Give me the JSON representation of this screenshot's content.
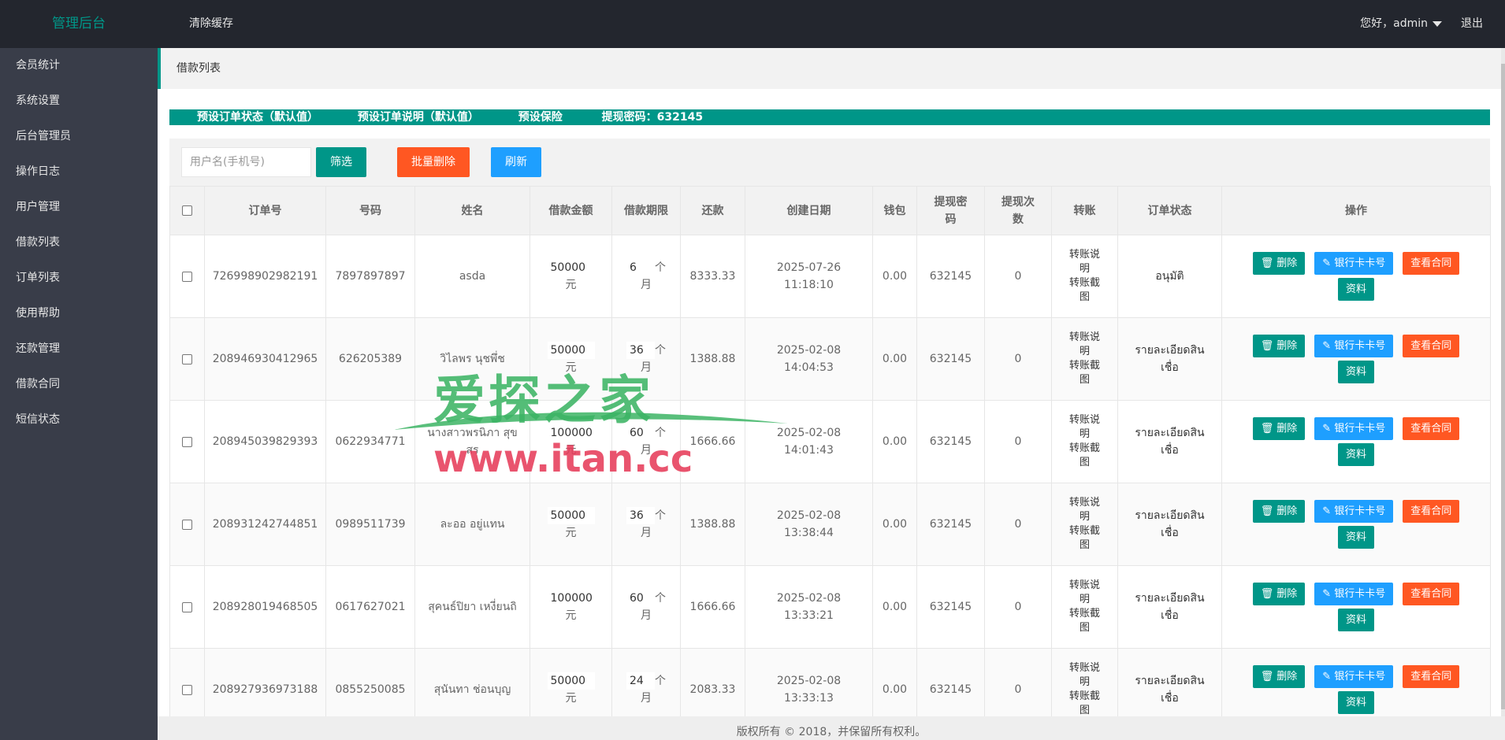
{
  "header": {
    "logo": "管理后台",
    "clear_cache": "清除缓存",
    "greeting": "您好，admin",
    "logout": "退出"
  },
  "sidebar": {
    "items": [
      {
        "label": "会员统计"
      },
      {
        "label": "系统设置"
      },
      {
        "label": "后台管理员"
      },
      {
        "label": "操作日志"
      },
      {
        "label": "用户管理"
      },
      {
        "label": "借款列表"
      },
      {
        "label": "订单列表"
      },
      {
        "label": "使用帮助"
      },
      {
        "label": "还款管理"
      },
      {
        "label": "借款合同"
      },
      {
        "label": "短信状态"
      }
    ]
  },
  "breadcrumb": "借款列表",
  "notice": {
    "status_default": "预设订单状态（默认值）",
    "desc_default": "预设订单说明（默认值）",
    "insurance": "预设保险",
    "withdraw_pw": "提现密码：632145"
  },
  "toolbar": {
    "search_placeholder": "用户名(手机号)",
    "filter": "筛选",
    "batch_delete": "批量删除",
    "refresh": "刷新"
  },
  "table": {
    "headers": [
      "订单号",
      "号码",
      "姓名",
      "借款金额",
      "借款期限",
      "还款",
      "创建日期",
      "钱包",
      "提现密\n码",
      "提现次\n数",
      "转账",
      "订单状态",
      "操作"
    ],
    "amount_unit": "元",
    "term_unit_1": "个",
    "term_unit_2": "月",
    "transfer_line1": "转账说\n明",
    "transfer_line2": "转账截\n图",
    "ops": {
      "delete": "删除",
      "bank": "银行卡卡号",
      "contract": "查看合同",
      "info": "资料"
    },
    "rows": [
      {
        "order": "726998902982191",
        "phone": "7897897897",
        "name": "asda",
        "amount": "50000",
        "term": "6",
        "repay": "8333.33",
        "date": "2025-07-26",
        "time": "11:18:10",
        "wallet": "0.00",
        "pw": "632145",
        "count": "0",
        "status": "อนุมัติ"
      },
      {
        "order": "208946930412965",
        "phone": "626205389",
        "name": "วิไลพร นุชพึ่ช",
        "amount": "50000",
        "term": "36",
        "repay": "1388.88",
        "date": "2025-02-08",
        "time": "14:04:53",
        "wallet": "0.00",
        "pw": "632145",
        "count": "0",
        "status": "รายละเอียดสิน\nเชื่อ"
      },
      {
        "order": "208945039829393",
        "phone": "0622934771",
        "name": "นางสาวพรนิภา สุข\nสร",
        "amount": "100000",
        "term": "60",
        "repay": "1666.66",
        "date": "2025-02-08",
        "time": "14:01:43",
        "wallet": "0.00",
        "pw": "632145",
        "count": "0",
        "status": "รายละเอียดสิน\nเชื่อ"
      },
      {
        "order": "208931242744851",
        "phone": "0989511739",
        "name": "ละออ อยู่แทน",
        "amount": "50000",
        "term": "36",
        "repay": "1388.88",
        "date": "2025-02-08",
        "time": "13:38:44",
        "wallet": "0.00",
        "pw": "632145",
        "count": "0",
        "status": "รายละเอียดสิน\nเชื่อ"
      },
      {
        "order": "208928019468505",
        "phone": "0617627021",
        "name": "สุคนธ์ปิยา เหงี่ยนถิ",
        "amount": "100000",
        "term": "60",
        "repay": "1666.66",
        "date": "2025-02-08",
        "time": "13:33:21",
        "wallet": "0.00",
        "pw": "632145",
        "count": "0",
        "status": "รายละเอียดสิน\nเชื่อ"
      },
      {
        "order": "208927936973188",
        "phone": "0855250085",
        "name": "สุนันทา ช่อนบุญ",
        "amount": "50000",
        "term": "24",
        "repay": "2083.33",
        "date": "2025-02-08",
        "time": "13:33:13",
        "wallet": "0.00",
        "pw": "632145",
        "count": "0",
        "status": "รายละเอียดสิน\nเชื่อ"
      }
    ]
  },
  "footer": "版权所有 © 2018，并保留所有权利。",
  "watermark": {
    "top": "爱探之家",
    "bottom": "www.itan.cc"
  },
  "colors": {
    "accent": "#009688",
    "danger": "#ff5722",
    "info": "#1e9fff",
    "header_bg": "#23262e",
    "sidebar_bg": "#393d49"
  }
}
